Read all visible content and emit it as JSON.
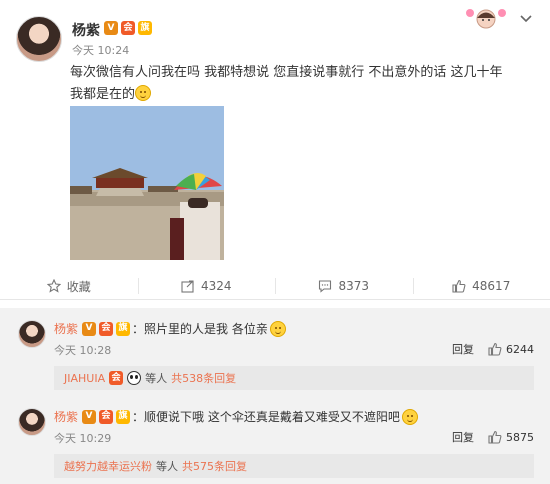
{
  "post": {
    "author": "杨紫",
    "time": "今天 10:24",
    "text": "每次微信有人问我在吗 我都特想说 您直接说事就行 不出意外的话 这几十年我都是在的",
    "badges": {
      "v": "V",
      "vip": "会",
      "flag": "旗"
    },
    "actions": {
      "favorite_label": "收藏",
      "repost_count": "4324",
      "comment_count": "8373",
      "like_count": "48617"
    }
  },
  "comments": [
    {
      "author": "杨紫",
      "sep": "：",
      "text": "照片里的人是我 各位亲",
      "time": "今天 10:28",
      "reply_label": "回复",
      "like_count": "6244",
      "sub": {
        "names": "JIAHUIA",
        "etc": "等人",
        "total": "共538条回复"
      }
    },
    {
      "author": "杨紫",
      "sep": "：",
      "text": "顺便说下哦 这个伞还真是戴着又难受又不遮阳吧",
      "time": "今天 10:29",
      "reply_label": "回复",
      "like_count": "5875",
      "sub": {
        "names": "越努力越幸运兴粉",
        "etc": "等人",
        "total": "共575条回复"
      }
    }
  ],
  "colors": {
    "accent": "#eb7350",
    "v_badge": "#e88a15",
    "comment_bg": "#f2f2f2"
  },
  "icons": [
    "star-icon",
    "repost-icon",
    "comment-icon",
    "like-icon",
    "chevron-down-icon"
  ]
}
